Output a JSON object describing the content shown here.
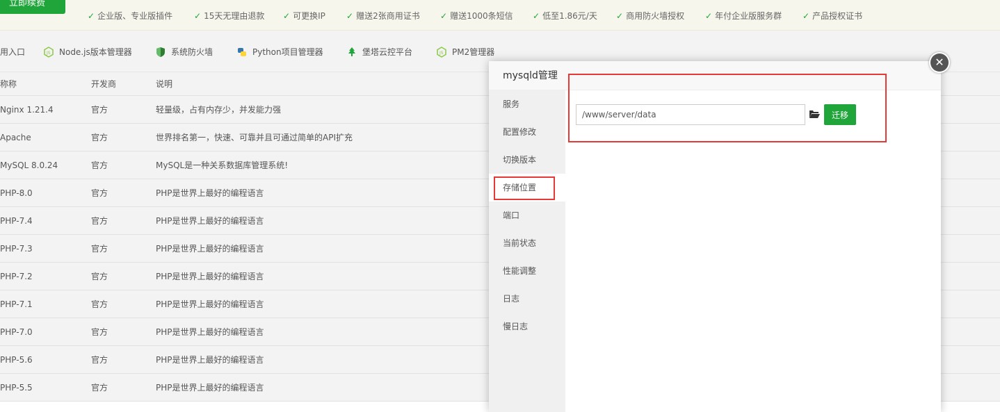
{
  "promo": {
    "renew_label": "立即续费",
    "features": [
      "企业版、专业版插件",
      "15天无理由退款",
      "可更换IP",
      "赠送2张商用证书",
      "赠送1000条短信",
      "低至1.86元/天",
      "商用防火墙授权",
      "年付企业版服务群",
      "产品授权证书"
    ]
  },
  "apps": [
    {
      "label": "用入口",
      "icon": "none"
    },
    {
      "label": "Node.js版本管理器",
      "icon": "nodejs-icon"
    },
    {
      "label": "系统防火墙",
      "icon": "shield-icon"
    },
    {
      "label": "Python项目管理器",
      "icon": "python-icon"
    },
    {
      "label": "堡塔云控平台",
      "icon": "tree-icon"
    },
    {
      "label": "PM2管理器",
      "icon": "nodejs-icon"
    }
  ],
  "table": {
    "headers": [
      "称称",
      "开发商",
      "说明"
    ],
    "rows": [
      [
        "Nginx 1.21.4",
        "官方",
        "轻量级，占有内存少，并发能力强"
      ],
      [
        "Apache",
        "官方",
        "世界排名第一，快速、可靠并且可通过简单的API扩充"
      ],
      [
        "MySQL 8.0.24",
        "官方",
        "MySQL是一种关系数据库管理系统!"
      ],
      [
        "PHP-8.0",
        "官方",
        "PHP是世界上最好的编程语言"
      ],
      [
        "PHP-7.4",
        "官方",
        "PHP是世界上最好的编程语言"
      ],
      [
        "PHP-7.3",
        "官方",
        "PHP是世界上最好的编程语言"
      ],
      [
        "PHP-7.2",
        "官方",
        "PHP是世界上最好的编程语言"
      ],
      [
        "PHP-7.1",
        "官方",
        "PHP是世界上最好的编程语言"
      ],
      [
        "PHP-7.0",
        "官方",
        "PHP是世界上最好的编程语言"
      ],
      [
        "PHP-5.6",
        "官方",
        "PHP是世界上最好的编程语言"
      ],
      [
        "PHP-5.5",
        "官方",
        "PHP是世界上最好的编程语言"
      ]
    ]
  },
  "modal": {
    "title": "mysqld管理",
    "menu": [
      "服务",
      "配置修改",
      "切换版本",
      "存储位置",
      "端口",
      "当前状态",
      "性能调整",
      "日志",
      "慢日志"
    ],
    "active_index": 3,
    "path_value": "/www/server/data",
    "migrate_label": "迁移",
    "close_symbol": "✕"
  },
  "colors": {
    "accent": "#20a53a",
    "highlight": "#e53935"
  }
}
